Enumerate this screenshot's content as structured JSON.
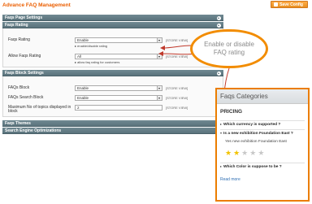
{
  "header": {
    "title": "Advance FAQ Management",
    "save_label": "Save Config"
  },
  "sections": {
    "page_settings": {
      "title": "Faqs Page Settings"
    },
    "rating": {
      "title": "Faqs Rating",
      "rows": [
        {
          "label": "Faqs Rating",
          "value": "Enable",
          "scope": "[STORE VIEW]",
          "note": "▸ enable/disable rating"
        },
        {
          "label": "Allow Faqs Rating",
          "value": "All",
          "scope": "[STORE VIEW]",
          "note": "▸ allow faq rating for customers"
        }
      ]
    },
    "block": {
      "title": "Faqs Block Settings",
      "rows": [
        {
          "label": "FAQs Block",
          "value": "Enable",
          "scope": "[STORE VIEW]"
        },
        {
          "label": "FAQs Search Block",
          "value": "Enable",
          "scope": "[STORE VIEW]"
        },
        {
          "label": "Maximum No of topics displayed in block",
          "value": "2",
          "scope": "[STORE VIEW]"
        }
      ]
    },
    "themes": {
      "title": "Faqs Themes"
    },
    "seo": {
      "title": "Search Engine Optimizations"
    }
  },
  "callout": {
    "line1": "Enable or disable",
    "line2": "FAQ rating"
  },
  "widget": {
    "title": "Faqs Categories",
    "category": "PRICING",
    "questions": [
      {
        "text": "Which currency is supported ?",
        "expanded": false
      },
      {
        "text": "Is a new exhibition Foundation East ?",
        "expanded": true,
        "answer": "Yes new exhibition Foundation East"
      },
      {
        "text": "Which Color is suppose to be ?",
        "expanded": false
      }
    ],
    "rating": {
      "value": 2,
      "max": 5
    },
    "read_more": "Read more"
  },
  "colors": {
    "accent": "#eb7d00",
    "section_header": "#5a737c",
    "star": "#f2c300",
    "link": "#2f6fb3"
  },
  "icons": {
    "save": "save-icon",
    "toggle": "collapse-toggle-icon",
    "star": "star-icon"
  }
}
